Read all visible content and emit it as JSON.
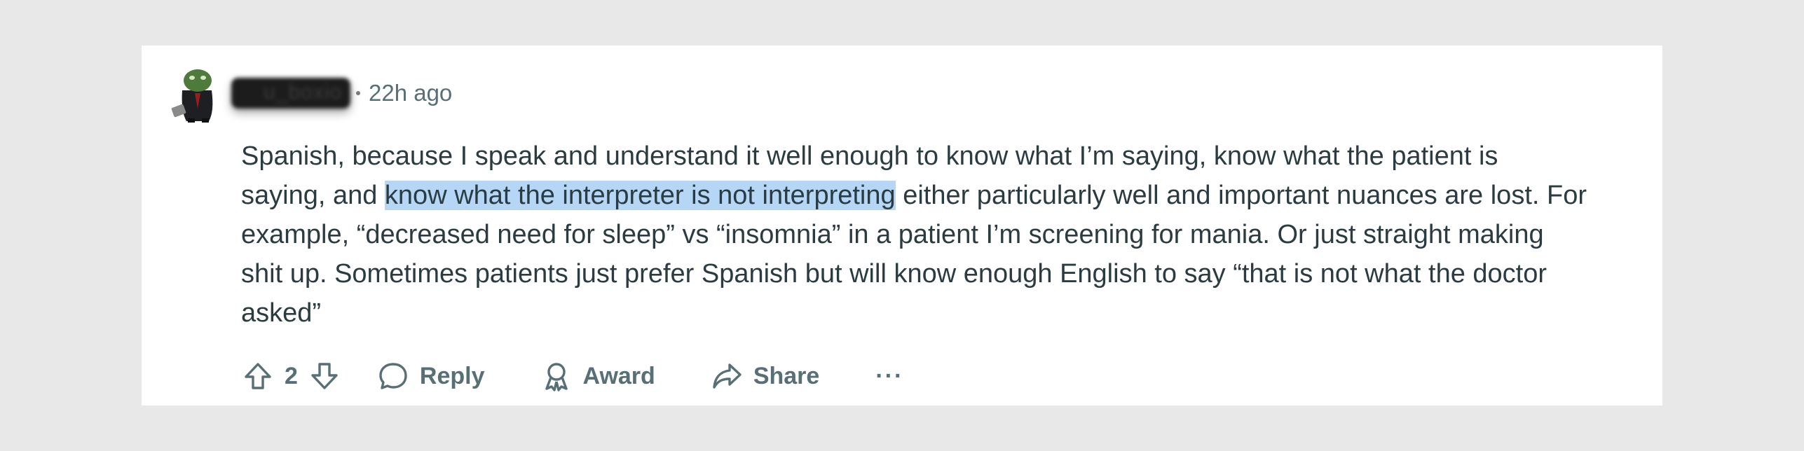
{
  "comment": {
    "timestamp": "22h ago",
    "body_before": "Spanish, because I speak and understand it well enough to know what I’m saying, know what the patient is saying, and ",
    "body_highlight": "know what the interpreter is not interpreting",
    "body_after": " either particularly well and important nuances are lost. For example, “decreased need for sleep” vs “insomnia” in a patient I’m screening for mania. Or just straight making shit up. Sometimes patients just prefer Spanish but will know enough English to say “that is not what the doctor asked”"
  },
  "actions": {
    "vote_count": "2",
    "reply_label": "Reply",
    "award_label": "Award",
    "share_label": "Share",
    "more_label": "···"
  },
  "icons": {
    "upvote": "arrow-up-icon",
    "downvote": "arrow-down-icon",
    "reply": "speech-bubble-icon",
    "award": "award-ribbon-icon",
    "share": "share-arrow-icon",
    "more": "ellipsis-icon"
  },
  "colors": {
    "highlight": "#b6d6f6",
    "text": "#2a3c42",
    "muted": "#576f76",
    "background": "#e8e8e8"
  }
}
